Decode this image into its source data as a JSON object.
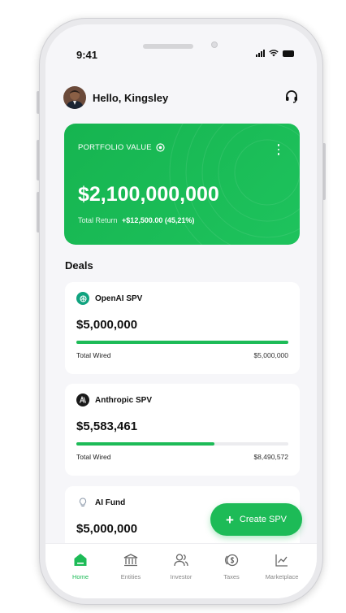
{
  "status_bar": {
    "time": "9:41"
  },
  "header": {
    "greeting": "Hello, Kingsley",
    "avatar_icon": "user-avatar",
    "support_icon": "headset-icon"
  },
  "portfolio": {
    "label": "PORTFOLIO VALUE",
    "value": "$2,100,000,000",
    "return_label": "Total Return",
    "return_value": "+$12,500.00 (45,21%)"
  },
  "deals": {
    "title": "Deals",
    "items": [
      {
        "name": "OpenAI SPV",
        "amount": "$5,000,000",
        "progress": 1.0,
        "footer_label": "Total Wired",
        "footer_value": "$5,000,000",
        "icon": "openai-icon"
      },
      {
        "name": "Anthropic SPV",
        "amount": "$5,583,461",
        "progress": 0.65,
        "footer_label": "Total Wired",
        "footer_value": "$8,490,572",
        "icon": "anthropic-icon"
      },
      {
        "name": "AI Fund",
        "amount": "$5,000,000",
        "icon": "bulb-icon"
      }
    ]
  },
  "fab": {
    "label": "Create SPV"
  },
  "tabs": [
    {
      "label": "Home",
      "icon": "home-icon",
      "active": true
    },
    {
      "label": "Entities",
      "icon": "bank-icon"
    },
    {
      "label": "Investor",
      "icon": "users-icon"
    },
    {
      "label": "Taxes",
      "icon": "coins-icon"
    },
    {
      "label": "Marketplace",
      "icon": "chart-icon"
    }
  ],
  "colors": {
    "accent": "#1dbb57",
    "background": "#f6f6f9"
  }
}
